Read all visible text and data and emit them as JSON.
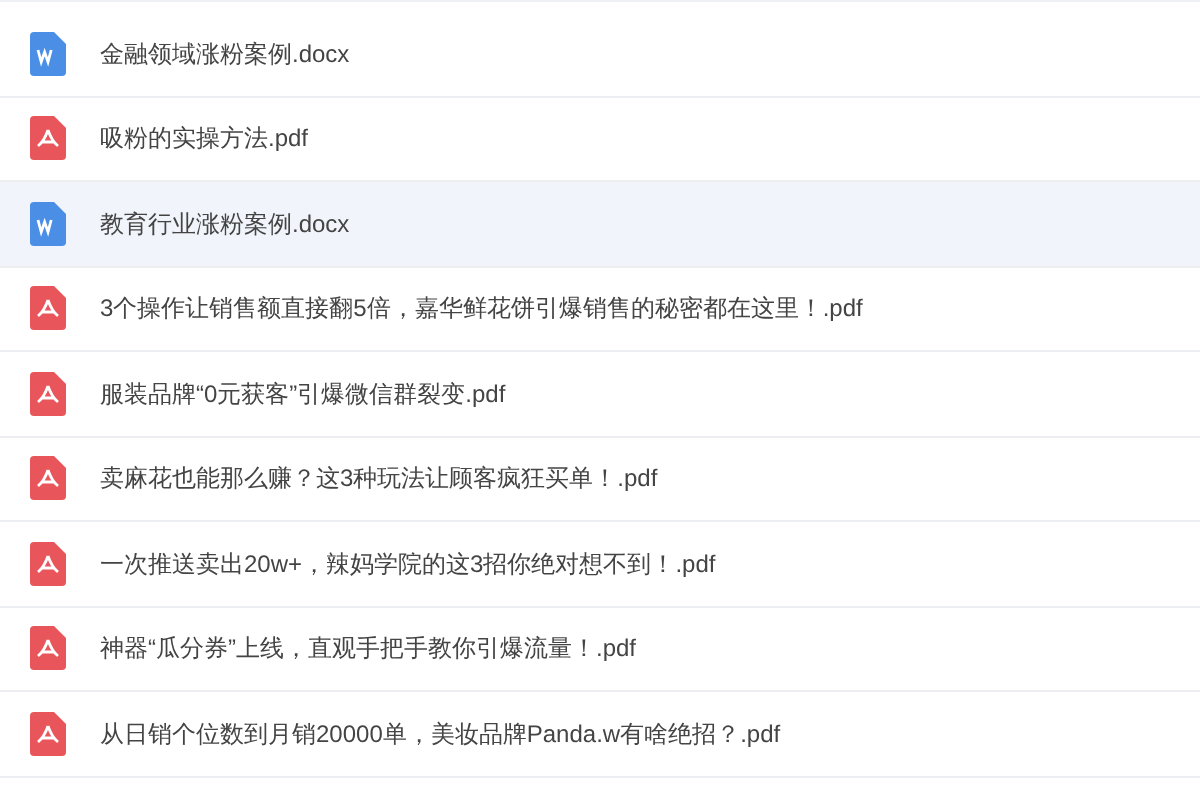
{
  "files": [
    {
      "kind": "word",
      "name": "金融领域涨粉案例.docx",
      "selected": false
    },
    {
      "kind": "pdf",
      "name": "吸粉的实操方法.pdf",
      "selected": false
    },
    {
      "kind": "word",
      "name": "教育行业涨粉案例.docx",
      "selected": true
    },
    {
      "kind": "pdf",
      "name": "3个操作让销售额直接翻5倍，嘉华鲜花饼引爆销售的秘密都在这里！.pdf",
      "selected": false
    },
    {
      "kind": "pdf",
      "name": "服装品牌“0元获客”引爆微信群裂变.pdf",
      "selected": false
    },
    {
      "kind": "pdf",
      "name": "卖麻花也能那么赚？这3种玩法让顾客疯狂买单！.pdf",
      "selected": false
    },
    {
      "kind": "pdf",
      "name": "一次推送卖出20w+，辣妈学院的这3招你绝对想不到！.pdf",
      "selected": false
    },
    {
      "kind": "pdf",
      "name": "神器“瓜分券”上线，直观手把手教你引爆流量！.pdf",
      "selected": false
    },
    {
      "kind": "pdf",
      "name": "从日销个位数到月销20000单，美妆品牌Panda.w有啥绝招？.pdf",
      "selected": false
    }
  ]
}
